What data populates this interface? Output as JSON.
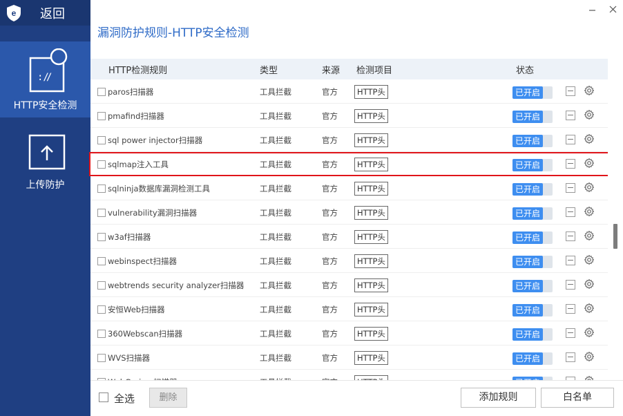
{
  "sidebar": {
    "back_label": "返回",
    "items": [
      {
        "label": "HTTP安全检测",
        "active": true
      },
      {
        "label": "上传防护",
        "active": false
      }
    ]
  },
  "header": {
    "title": "漏洞防护规则-HTTP安全检测"
  },
  "table": {
    "columns": [
      "HTTP检测规则",
      "类型",
      "来源",
      "检测项目",
      "状态"
    ],
    "rows": [
      {
        "name": "paros扫描器",
        "type": "工具拦截",
        "source": "官方",
        "item": "HTTP头",
        "status": "已开启"
      },
      {
        "name": "pmafind扫描器",
        "type": "工具拦截",
        "source": "官方",
        "item": "HTTP头",
        "status": "已开启"
      },
      {
        "name": "sql power injector扫描器",
        "type": "工具拦截",
        "source": "官方",
        "item": "HTTP头",
        "status": "已开启"
      },
      {
        "name": "sqlmap注入工具",
        "type": "工具拦截",
        "source": "官方",
        "item": "HTTP头",
        "status": "已开启"
      },
      {
        "name": "sqlninja数据库漏洞检测工具",
        "type": "工具拦截",
        "source": "官方",
        "item": "HTTP头",
        "status": "已开启"
      },
      {
        "name": "vulnerability漏洞扫描器",
        "type": "工具拦截",
        "source": "官方",
        "item": "HTTP头",
        "status": "已开启"
      },
      {
        "name": "w3af扫描器",
        "type": "工具拦截",
        "source": "官方",
        "item": "HTTP头",
        "status": "已开启"
      },
      {
        "name": "webinspect扫描器",
        "type": "工具拦截",
        "source": "官方",
        "item": "HTTP头",
        "status": "已开启"
      },
      {
        "name": "webtrends security analyzer扫描器",
        "type": "工具拦截",
        "source": "官方",
        "item": "HTTP头",
        "status": "已开启"
      },
      {
        "name": "安恒Web扫描器",
        "type": "工具拦截",
        "source": "官方",
        "item": "HTTP头",
        "status": "已开启"
      },
      {
        "name": "360Webscan扫描器",
        "type": "工具拦截",
        "source": "官方",
        "item": "HTTP头",
        "status": "已开启"
      },
      {
        "name": "WVS扫描器",
        "type": "工具拦截",
        "source": "官方",
        "item": "HTTP头",
        "status": "已开启"
      },
      {
        "name": "WebCruiser扫描器",
        "type": "工具拦截",
        "source": "官方",
        "item": "HTTP头",
        "status": "已开启"
      }
    ],
    "highlighted_row": 3
  },
  "footer": {
    "select_all_label": "全选",
    "delete_label": "删除",
    "add_rule_label": "添加规则",
    "whitelist_label": "白名单"
  },
  "colors": {
    "sidebar_bg": "#1f3f82",
    "sidebar_active": "#2b58ab",
    "title_blue": "#2f6bc7",
    "toggle_on": "#3e8ef0",
    "highlight_red": "#e0141a"
  }
}
